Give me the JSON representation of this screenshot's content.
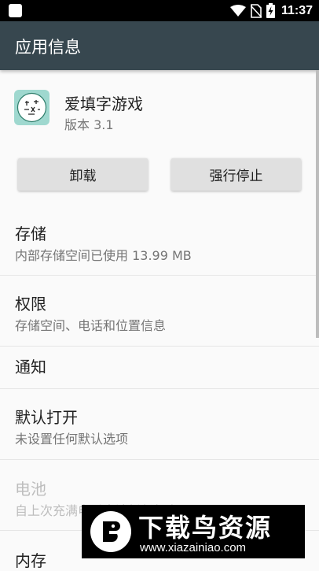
{
  "status_bar": {
    "time": "11:37"
  },
  "app_bar": {
    "title": "应用信息"
  },
  "app": {
    "name": "爱填字游戏",
    "version": "版本 3.1"
  },
  "buttons": {
    "uninstall": "卸载",
    "force_stop": "强行停止"
  },
  "sections": {
    "storage": {
      "title": "存储",
      "subtitle": "内部存储空间已使用 13.99 MB"
    },
    "permissions": {
      "title": "权限",
      "subtitle": "存储空间、电话和位置信息"
    },
    "notifications": {
      "title": "通知"
    },
    "open_by_default": {
      "title": "默认打开",
      "subtitle": "未设置任何默认选项"
    },
    "battery": {
      "title": "电池",
      "subtitle": "自上次充满电后未消耗任何电量"
    },
    "memory": {
      "title": "内存"
    }
  },
  "watermark": {
    "title": "下载鸟资源",
    "url": "www.xiazainiao.com"
  },
  "colors": {
    "app_bar": "#37474f",
    "status_bar": "#000000",
    "button": "#e0e0e0"
  }
}
